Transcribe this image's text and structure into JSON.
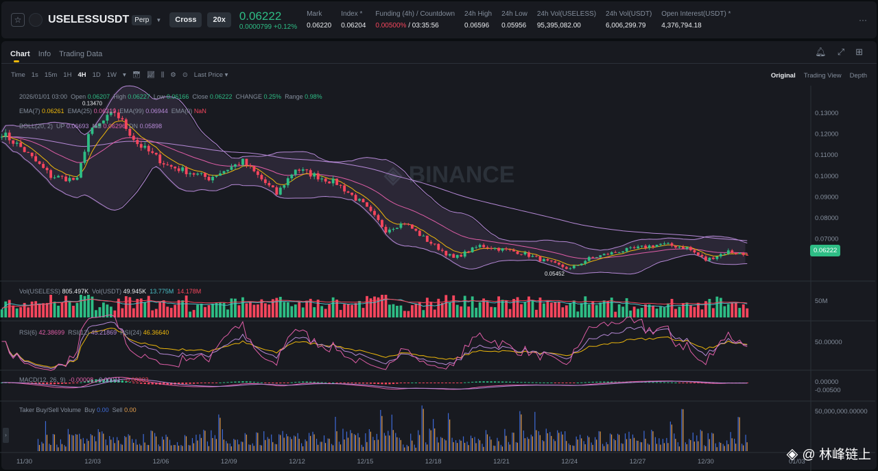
{
  "header": {
    "symbol": "USELESSUSDT",
    "contract": "Perp",
    "margin_mode": "Cross",
    "leverage": "20x",
    "last_price": "0.06222",
    "change": "0.0000799 +0.12%",
    "stats": [
      {
        "label": "Mark",
        "value": "0.06220"
      },
      {
        "label": "Index *",
        "value": "0.06204"
      },
      {
        "label": "Funding (4h) / Countdown",
        "value": "0.00500%",
        "value2": " / 03:35:56"
      },
      {
        "label": "24h High",
        "value": "0.06596"
      },
      {
        "label": "24h Low",
        "value": "0.05956"
      },
      {
        "label": "24h Vol(USELESS)",
        "value": "95,395,082.00"
      },
      {
        "label": "24h Vol(USDT)",
        "value": "6,006,299.79"
      },
      {
        "label": "Open Interest(USDT) *",
        "value": "4,376,794.18"
      }
    ],
    "more": "···"
  },
  "tabs": [
    "Chart",
    "Info",
    "Trading Data"
  ],
  "toolbar": {
    "intervals": [
      "Time",
      "1s",
      "15m",
      "1H",
      "4H",
      "1D",
      "1W"
    ],
    "active": "4H",
    "price_type": "Last Price"
  },
  "views": [
    "Original",
    "Trading View",
    "Depth"
  ],
  "ohlc": {
    "date": "2026/01/01 03:00",
    "open_l": "Open",
    "open": "0.06207",
    "high_l": "High",
    "high": "0.06227",
    "low_l": "Low",
    "low": "0.06166",
    "close_l": "Close",
    "close": "0.06222",
    "change_l": "CHANGE",
    "change": "0.25%",
    "range_l": "Range",
    "range": "0.98%"
  },
  "ema": {
    "l7": "EMA(7)",
    "v7": "0.06261",
    "l25": "EMA(25)",
    "v25": "0.06319",
    "l99": "EMA(99)",
    "v99": "0.06944",
    "l0": "EMA(0)",
    "v0": "NaN"
  },
  "boll": {
    "l": "BOLL(20, 2)",
    "up_l": "UP",
    "up": "0.06693",
    "mb_l": "MB",
    "mb": "0.06296",
    "dn_l": "DN",
    "dn": "0.05898"
  },
  "vol": {
    "l1": "Vol(USELESS)",
    "v1": "805.497K",
    "l2": "Vol(USDT)",
    "v2": "49.945K",
    "ma1": "13.775M",
    "ma2": "14.178M"
  },
  "rsi": {
    "l6": "RSI(6)",
    "v6": "42.38699",
    "l12": "RSI(12)",
    "v12": "45.21869",
    "l24": "RSI(24)",
    "v24": "46.36640"
  },
  "macd": {
    "l": "MACD(12, 26, 9)",
    "dif": "-0.00008",
    "dea": "-0.00011",
    "hist": "-0.00003"
  },
  "taker": {
    "l": "Taker Buy/Sell Volume",
    "buy_l": "Buy",
    "buy": "0.00",
    "sell_l": "Sell",
    "sell": "0.00"
  },
  "watermark": "@ 林峰链上",
  "chart_data": {
    "type": "candlestick",
    "interval": "4H",
    "price_path": [
      [
        0,
        0.1205
      ],
      [
        5,
        0.1137
      ],
      [
        13,
        0.1
      ],
      [
        20,
        0.098
      ],
      [
        23,
        0.12
      ],
      [
        30,
        0.1307
      ],
      [
        36,
        0.1155
      ],
      [
        44,
        0.105
      ],
      [
        55,
        0.099
      ],
      [
        64,
        0.107
      ],
      [
        73,
        0.0915
      ],
      [
        78,
        0.1035
      ],
      [
        89,
        0.0966
      ],
      [
        96,
        0.0864
      ],
      [
        102,
        0.0744
      ],
      [
        107,
        0.0778
      ],
      [
        113,
        0.0693
      ],
      [
        120,
        0.0608
      ],
      [
        127,
        0.0669
      ],
      [
        138,
        0.0635
      ],
      [
        145,
        0.0591
      ],
      [
        151,
        0.0557
      ],
      [
        156,
        0.0608
      ],
      [
        164,
        0.0642
      ],
      [
        175,
        0.0676
      ],
      [
        182,
        0.0659
      ],
      [
        187,
        0.06
      ],
      [
        193,
        0.0642
      ],
      [
        198,
        0.0622
      ]
    ],
    "marked_high": "0.13470",
    "marked_low": "0.05452",
    "y_ticks": [
      "0.13000",
      "0.12000",
      "0.11000",
      "0.10000",
      "0.09000",
      "0.08000",
      "0.07000"
    ],
    "y_range": [
      0.05,
      0.143
    ],
    "vol_tick": "50M",
    "rsi_tick": "50.00000",
    "macd_ticks": [
      "0.00000",
      "-0.00500"
    ],
    "taker_tick": "50,000,000.00000",
    "x_ticks": [
      "11/30",
      "12/03",
      "12/06",
      "12/09",
      "12/12",
      "12/15",
      "12/18",
      "12/21",
      "12/24",
      "12/27",
      "12/30",
      "01/03"
    ],
    "colors": {
      "up": "#2ebd85",
      "down": "#f6465d",
      "ema7": "#f0b90b",
      "ema25": "#e15ea8",
      "ema99": "#b78ad8",
      "boll": "#b78ad8"
    }
  }
}
